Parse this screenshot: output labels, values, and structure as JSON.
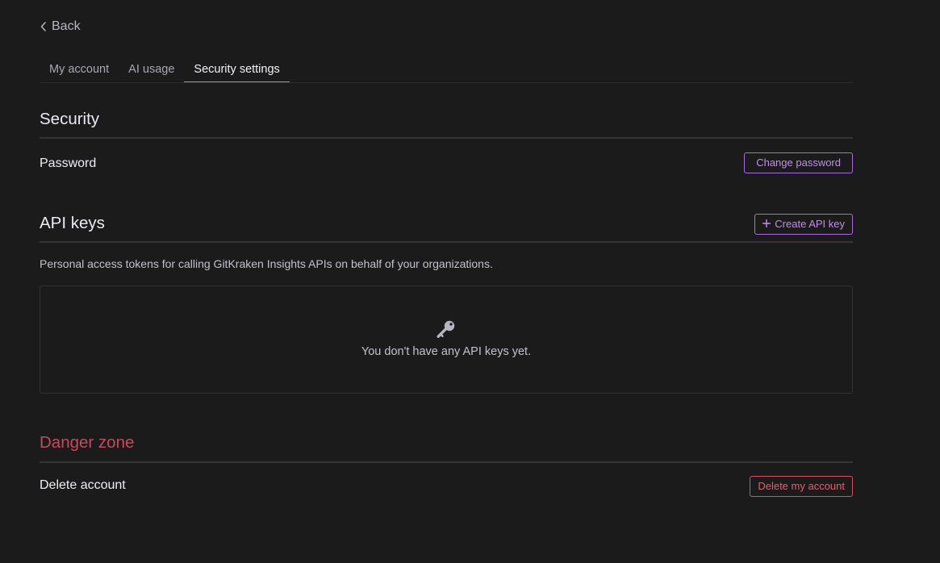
{
  "nav": {
    "back_label": "Back"
  },
  "tabs": [
    {
      "label": "My account",
      "active": false
    },
    {
      "label": "AI usage",
      "active": false
    },
    {
      "label": "Security settings",
      "active": true
    }
  ],
  "security": {
    "title": "Security",
    "password_label": "Password",
    "change_password_label": "Change password"
  },
  "api_keys": {
    "title": "API keys",
    "create_label": "Create API key",
    "description": "Personal access tokens for calling GitKraken Insights APIs on behalf of your organizations.",
    "empty_icon": "key-icon",
    "empty_text": "You don't have any API keys yet."
  },
  "danger": {
    "title": "Danger zone",
    "delete_label": "Delete account",
    "delete_button_label": "Delete my account"
  },
  "colors": {
    "background": "#1c1b1c",
    "accent": "#b77ae0",
    "danger": "#c9475f"
  }
}
